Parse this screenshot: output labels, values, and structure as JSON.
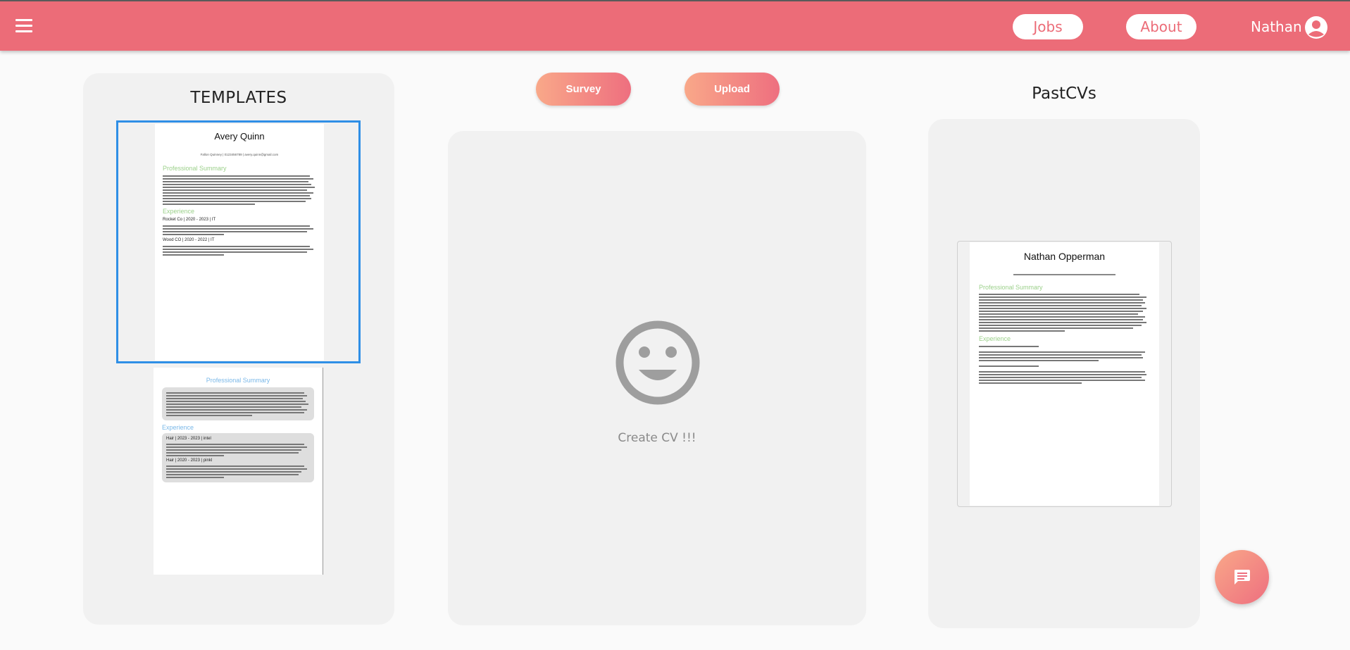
{
  "nav": {
    "jobs_label": "Jobs",
    "about_label": "About",
    "user_name": "Nathan"
  },
  "templates": {
    "title": "TEMPLATES",
    "template1": {
      "name": "Avery Quinn",
      "contact": "Fallon Quinney | 0123456789 | avery.quinn@gmail.com",
      "summary_heading": "Professional Summary",
      "experience_heading": "Experience",
      "job1": "Rocket Co | 2020 - 2023 | IT",
      "job2": "Wood CO | 2020 - 2022 | IT"
    },
    "template2": {
      "summary_heading": "Professional Summary",
      "experience_heading": "Experience",
      "job1": "Hair | 2023 - 2023 | intel",
      "job2": "Hair | 2020 - 2023 | pinkl"
    }
  },
  "actions": {
    "survey_label": "Survey",
    "upload_label": "Upload"
  },
  "create": {
    "label": "Create CV !!!"
  },
  "past_cvs": {
    "title": "PastCVs",
    "cv1": {
      "name": "Nathan Opperman",
      "summary_heading": "Professional Summary",
      "experience_heading": "Experience"
    }
  },
  "colors": {
    "brand": "#ec6c78",
    "accent_gradient_start": "#f9a889",
    "accent_gradient_end": "#ee6f7f",
    "selection": "#2f8fe6",
    "summary_green": "#9bd08a",
    "summary_blue": "#7ab8e8"
  },
  "icons": {
    "menu": "menu-icon",
    "account": "account-circle-icon",
    "smiley": "smiley-face-icon",
    "chat": "chat-bubble-icon"
  }
}
